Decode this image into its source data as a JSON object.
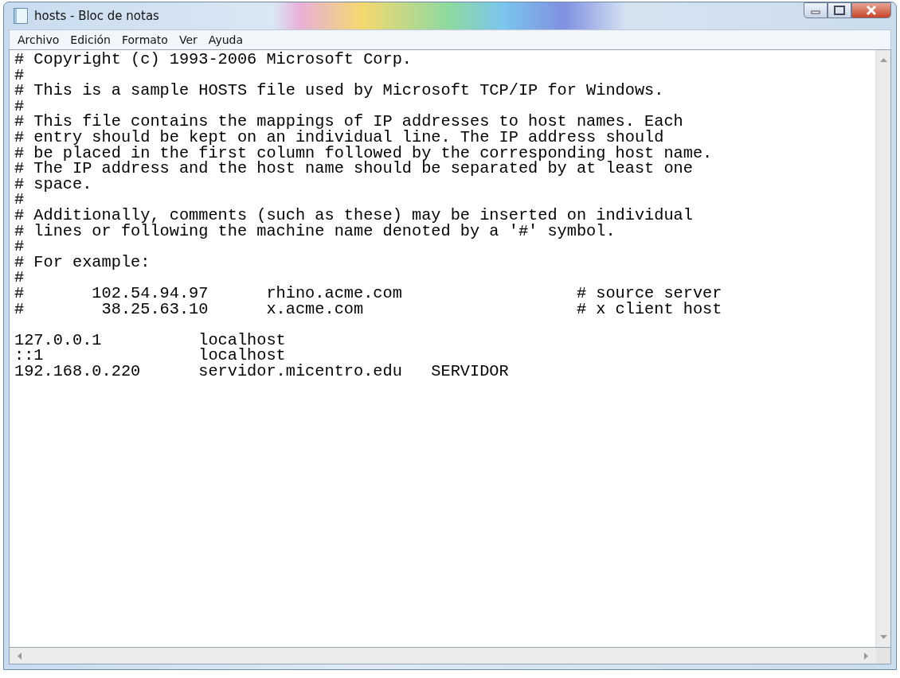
{
  "window": {
    "title": "hosts - Bloc de notas"
  },
  "menu": [
    "Archivo",
    "Edición",
    "Formato",
    "Ver",
    "Ayuda"
  ],
  "editor": {
    "comment_lines": [
      "# Copyright (c) 1993-2006 Microsoft Corp.",
      "#",
      "# This is a sample HOSTS file used by Microsoft TCP/IP for Windows.",
      "#",
      "# This file contains the mappings of IP addresses to host names. Each",
      "# entry should be kept on an individual line. The IP address should",
      "# be placed in the first column followed by the corresponding host name.",
      "# The IP address and the host name should be separated by at least one",
      "# space.",
      "#",
      "# Additionally, comments (such as these) may be inserted on individual",
      "# lines or following the machine name denoted by a '#' symbol.",
      "#",
      "# For example:",
      "#",
      "#       102.54.94.97      rhino.acme.com                  # source server",
      "#        38.25.63.10      x.acme.com                      # x client host"
    ],
    "entry_lines": [
      "127.0.0.1          localhost",
      "::1                localhost",
      "192.168.0.220      servidor.micentro.edu   SERVIDOR"
    ]
  }
}
